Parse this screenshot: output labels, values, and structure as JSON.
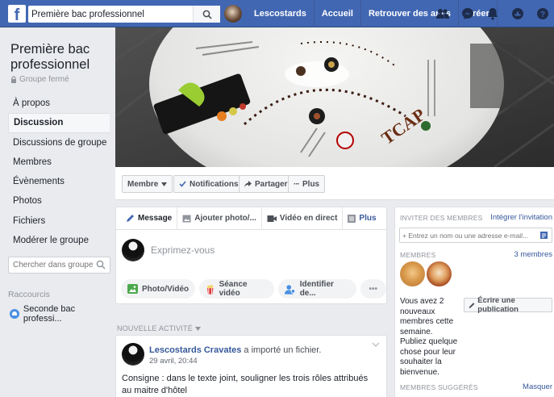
{
  "topbar": {
    "logo": "f",
    "search_value": "Première bac professionnel",
    "nav": [
      "Lescostards",
      "Accueil",
      "Retrouver des amis",
      "Créer"
    ],
    "icons": [
      "friends-icon",
      "messenger-icon",
      "notifications-icon",
      "quick-help-icon",
      "help-icon"
    ]
  },
  "group": {
    "name": "Première bac professionnel",
    "type": "Groupe fermé"
  },
  "sidebar": {
    "items": [
      {
        "label": "À propos"
      },
      {
        "label": "Discussion"
      },
      {
        "label": "Discussions de groupe"
      },
      {
        "label": "Membres"
      },
      {
        "label": "Évènements"
      },
      {
        "label": "Photos"
      },
      {
        "label": "Fichiers"
      },
      {
        "label": "Modérer le groupe"
      }
    ],
    "search_placeholder": "Chercher dans groupe",
    "shortcuts_title": "Raccourcis",
    "shortcut": "Seconde bac professi..."
  },
  "actions": {
    "member": "Membre",
    "notifications": "Notifications",
    "share": "Partager",
    "more": "Plus"
  },
  "composer": {
    "tabs": [
      "Message",
      "Ajouter photo/...",
      "Vidéo en direct",
      "Plus"
    ],
    "placeholder": "Exprimez-vous",
    "buttons": [
      "Photo/Vidéo",
      "Séance vidéo",
      "Identifier de...",
      "•••"
    ]
  },
  "feed": {
    "label": "NOUVELLE ACTIVITÉ",
    "post": {
      "author": "Lescostards Cravates",
      "action": " a importé un fichier.",
      "date": "29 avril, 20:44",
      "text": "Consigne : dans le texte joint, souligner les trois rôles attribués au maitre d'hôtel"
    }
  },
  "right": {
    "invite_title": "INVITER DES MEMBRES",
    "integrate": "Intégrer l'invitation",
    "invite_placeholder": "+ Entrez un nom ou une adresse e-mail...",
    "members_title": "MEMBRES",
    "members_count": "3 membres",
    "members_text": "Vous avez 2 nouveaux membres cette semaine. Publiez quelque chose pour leur souhaiter la bienvenue.",
    "write_post": "Écrire une publication",
    "suggested_title": "MEMBRES SUGGÉRÉS",
    "hide": "Masquer"
  },
  "colors": {
    "brand": "#4267b2",
    "link": "#365899"
  }
}
